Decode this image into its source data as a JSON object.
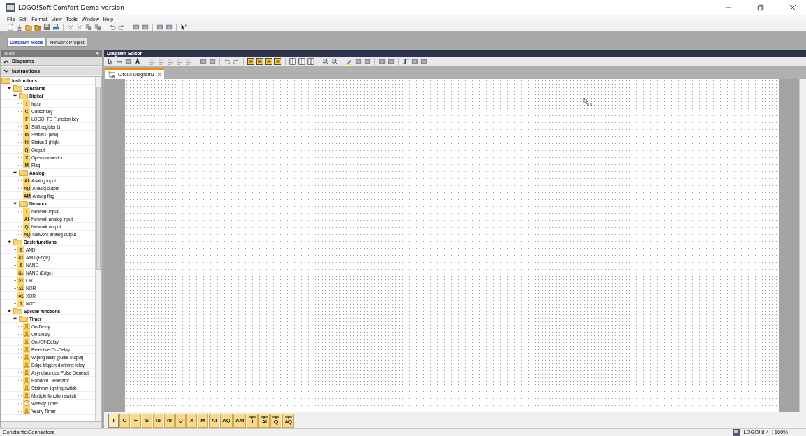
{
  "window": {
    "title": "LOGO!Soft Comfort Demo version"
  },
  "menu": [
    "File",
    "Edit",
    "Format",
    "View",
    "Tools",
    "Window",
    "Help"
  ],
  "mode_tabs": [
    {
      "label": "Diagram Mode",
      "selected": true
    },
    {
      "label": "Network Project",
      "selected": false
    }
  ],
  "tools_panel": {
    "title": "Tools",
    "sections": [
      {
        "label": "Diagrams",
        "expanded": false
      },
      {
        "label": "Instructions",
        "expanded": true
      }
    ],
    "tree": {
      "label": "Instructions",
      "kind": "root",
      "children": [
        {
          "label": "Constants",
          "kind": "folder",
          "expanded": true,
          "children": [
            {
              "label": "Digital",
              "kind": "folder",
              "expanded": true,
              "children": [
                {
                  "label": "Input",
                  "kind": "item",
                  "badge": "I"
                },
                {
                  "label": "Cursor key",
                  "kind": "item",
                  "badge": "C"
                },
                {
                  "label": "LOGO! TD Function key",
                  "kind": "item",
                  "badge": "F"
                },
                {
                  "label": "Shift register bit",
                  "kind": "item",
                  "badge": "S"
                },
                {
                  "label": "Status 0 (low)",
                  "kind": "item",
                  "badge": "lo"
                },
                {
                  "label": "Status 1 (high)",
                  "kind": "item",
                  "badge": "hi"
                },
                {
                  "label": "Output",
                  "kind": "item",
                  "badge": "Q"
                },
                {
                  "label": "Open connector",
                  "kind": "item",
                  "badge": "X"
                },
                {
                  "label": "Flag",
                  "kind": "item",
                  "badge": "M"
                }
              ]
            },
            {
              "label": "Analog",
              "kind": "folder",
              "expanded": true,
              "children": [
                {
                  "label": "Analog input",
                  "kind": "item",
                  "badge": "AI"
                },
                {
                  "label": "Analog output",
                  "kind": "item",
                  "badge": "AQ"
                },
                {
                  "label": "Analog flag",
                  "kind": "item",
                  "badge": "AM"
                }
              ]
            },
            {
              "label": "Network",
              "kind": "folder",
              "expanded": true,
              "children": [
                {
                  "label": "Network input",
                  "kind": "item",
                  "badge": "I"
                },
                {
                  "label": "Network analog input",
                  "kind": "item",
                  "badge": "AI"
                },
                {
                  "label": "Network output",
                  "kind": "item",
                  "badge": "Q"
                },
                {
                  "label": "Network analog output",
                  "kind": "item",
                  "badge": "AQ"
                }
              ]
            }
          ]
        },
        {
          "label": "Basic functions",
          "kind": "folder",
          "expanded": true,
          "children": [
            {
              "label": "AND",
              "kind": "item",
              "badge": "&"
            },
            {
              "label": "AND (Edge)",
              "kind": "item",
              "badge": "&↑"
            },
            {
              "label": "NAND",
              "kind": "item",
              "badge": "&"
            },
            {
              "label": "NAND (Edge)",
              "kind": "item",
              "badge": "&↓"
            },
            {
              "label": "OR",
              "kind": "item",
              "badge": "≥1"
            },
            {
              "label": "NOR",
              "kind": "item",
              "badge": "≥1"
            },
            {
              "label": "XOR",
              "kind": "item",
              "badge": "=1"
            },
            {
              "label": "NOT",
              "kind": "item",
              "badge": "1"
            }
          ]
        },
        {
          "label": "Special functions",
          "kind": "folder",
          "expanded": true,
          "children": [
            {
              "label": "Timer",
              "kind": "folder",
              "expanded": true,
              "children": [
                {
                  "label": "On-Delay",
                  "kind": "timer"
                },
                {
                  "label": "Off-Delay",
                  "kind": "timer"
                },
                {
                  "label": "On-/Off-Delay",
                  "kind": "timer"
                },
                {
                  "label": "Retentive On-Delay",
                  "kind": "timer"
                },
                {
                  "label": "Wiping relay (pulse output)",
                  "kind": "timer"
                },
                {
                  "label": "Edge triggered wiping relay",
                  "kind": "timer"
                },
                {
                  "label": "Asynchronous Pulse Generat",
                  "kind": "timer"
                },
                {
                  "label": "Random Generator",
                  "kind": "timer"
                },
                {
                  "label": "Stairway lighting switch",
                  "kind": "timer"
                },
                {
                  "label": "Multiple function switch",
                  "kind": "timer"
                },
                {
                  "label": "Weekly Timer",
                  "kind": "clock"
                },
                {
                  "label": "Yearly Timer",
                  "kind": "timer"
                }
              ]
            }
          ]
        }
      ]
    }
  },
  "editor": {
    "title": "Diagram Editor",
    "tabs": [
      {
        "label": "Circuit Diagram1",
        "selected": true
      }
    ]
  },
  "palette": [
    {
      "label": "I",
      "kind": "plain",
      "selected": true
    },
    {
      "label": "C",
      "kind": "plain",
      "selected": false
    },
    {
      "label": "F",
      "kind": "plain",
      "selected": false
    },
    {
      "label": "S",
      "kind": "plain",
      "selected": false
    },
    {
      "label": "lo",
      "kind": "plain",
      "selected": false
    },
    {
      "label": "hi",
      "kind": "plain",
      "selected": false
    },
    {
      "label": "Q",
      "kind": "plain",
      "selected": false
    },
    {
      "label": "X",
      "kind": "plain",
      "selected": false
    },
    {
      "label": "M",
      "kind": "plain",
      "selected": false
    },
    {
      "label": "AI",
      "kind": "plain",
      "selected": false
    },
    {
      "label": "AQ",
      "kind": "plain",
      "selected": false
    },
    {
      "label": "AM",
      "kind": "plain",
      "selected": false
    },
    {
      "label": "I",
      "kind": "network",
      "selected": false
    },
    {
      "label": "AI",
      "kind": "network",
      "selected": false
    },
    {
      "label": "Q",
      "kind": "network",
      "selected": false
    },
    {
      "label": "AQ",
      "kind": "network",
      "selected": false
    }
  ],
  "status_bar": {
    "text": "Constants\\Connectors",
    "device": "LOGO! 8.4",
    "zoom": "100%"
  }
}
